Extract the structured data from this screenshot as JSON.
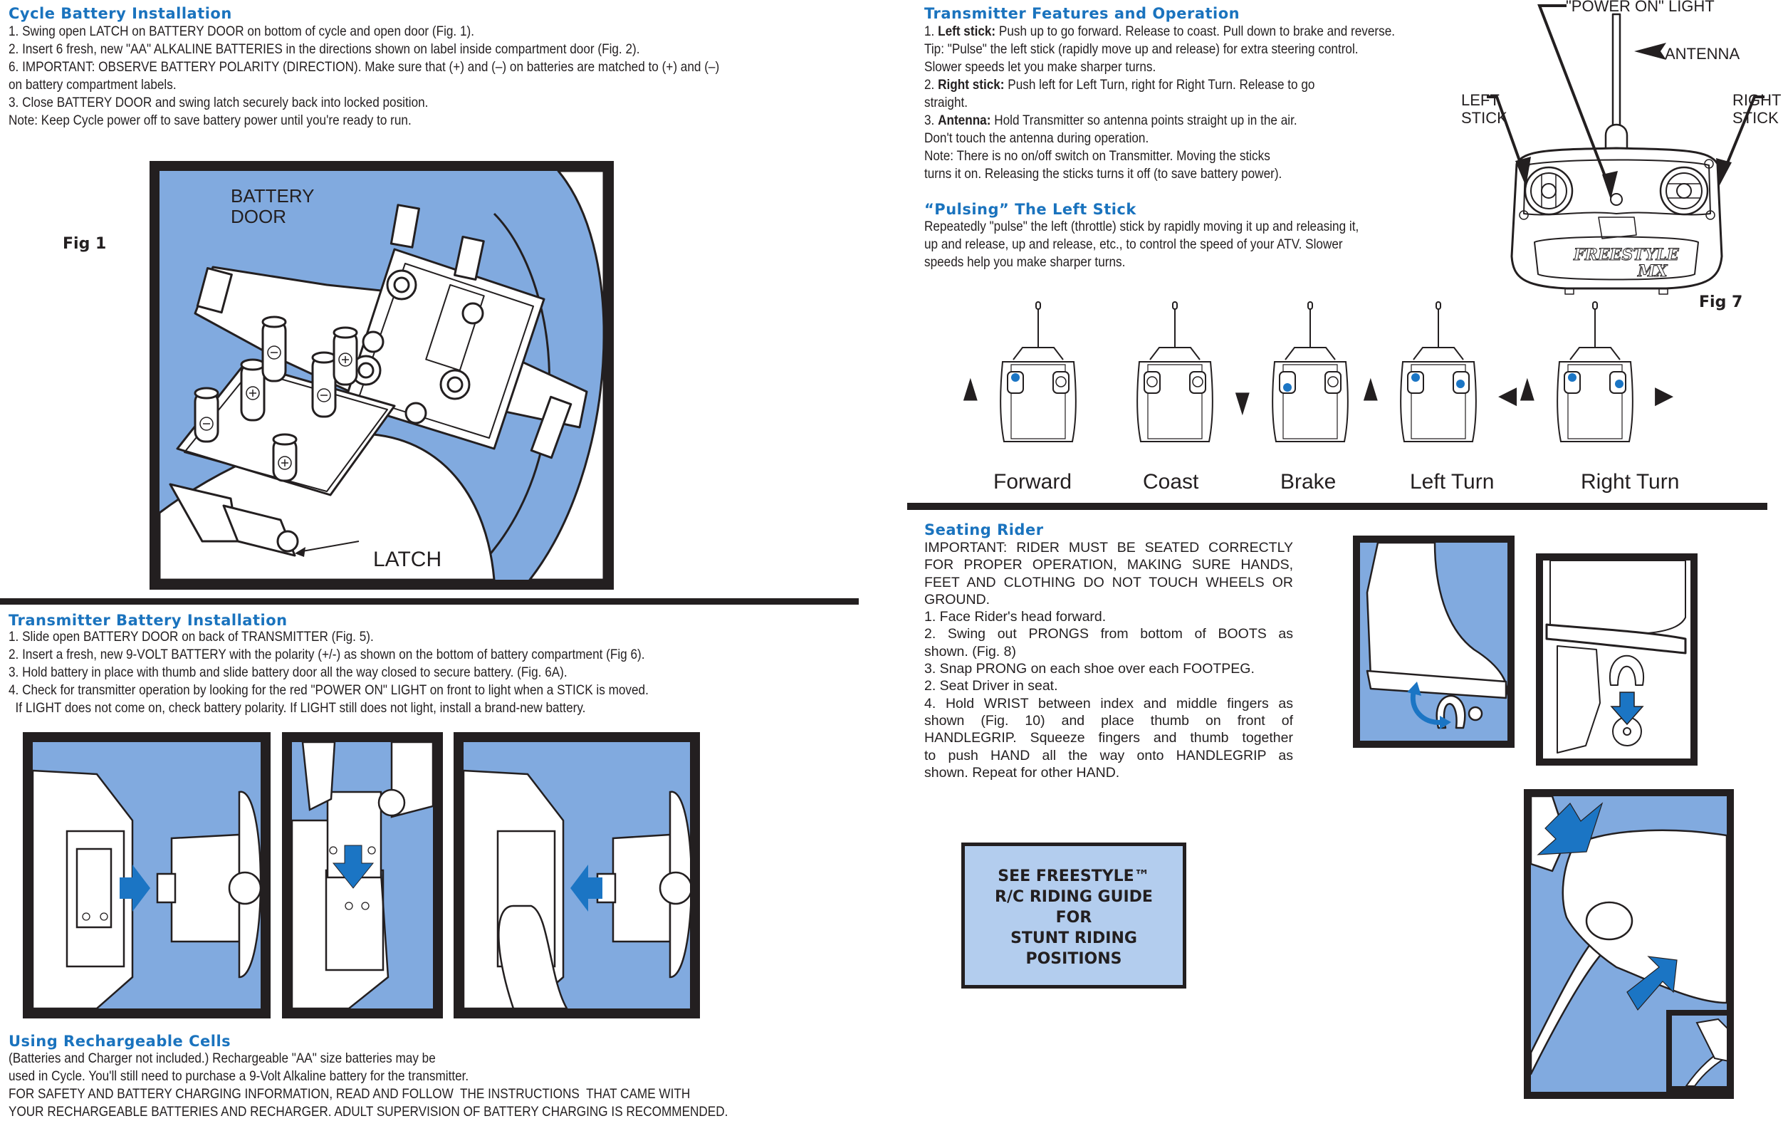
{
  "cycle_battery": {
    "title": "Cycle Battery Installation",
    "lines": [
      "1. Swing open LATCH on BATTERY DOOR on bottom of cycle and open door (Fig. 1).",
      "2. Insert 6 fresh, new \"AA\" ALKALINE BATTERIES in the directions shown on label inside compartment door (Fig. 2).",
      "6. IMPORTANT: OBSERVE BATTERY POLARITY (DIRECTION). Make sure that (+) and (–) on batteries are matched to (+) and (–)",
      "on battery compartment labels.",
      "3. Close BATTERY DOOR and swing latch securely back into locked position.",
      "Note: Keep Cycle power off to save battery power until you're ready to run."
    ],
    "fig_label": "Fig 1",
    "figure_labels": {
      "battery_door_1": "BATTERY",
      "battery_door_2": "DOOR",
      "latch": "LATCH"
    },
    "polarity": {
      "plus": "+",
      "minus": "–"
    }
  },
  "transmitter_battery": {
    "title": "Transmitter Battery Installation",
    "lines": [
      "1. Slide open BATTERY DOOR on back of  TRANSMITTER (Fig. 5).",
      "2. Insert a fresh, new 9-VOLT BATTERY with the polarity (+/-) as shown on the bottom of battery compartment (Fig 6).",
      "3. Hold battery in place with thumb and slide battery door all the way closed to secure battery. (Fig. 6A).",
      "4. Check for transmitter operation by looking for the red \"POWER ON\" LIGHT on front to light when a STICK is moved.",
      "  If LIGHT does not come on, check battery polarity. If LIGHT still does not light, install a brand-new battery."
    ]
  },
  "rechargeable": {
    "title": "Using Rechargeable Cells",
    "lines": [
      "(Batteries and Charger not included.) Rechargeable \"AA\" size batteries may be",
      "used in Cycle. You'll still need to purchase a 9-Volt Alkaline battery for the transmitter.",
      "FOR SAFETY AND BATTERY CHARGING INFORMATION, READ AND FOLLOW  THE INSTRUCTIONS  THAT CAME WITH",
      "YOUR RECHARGEABLE BATTERIES AND RECHARGER. ADULT SUPERVISION OF BATTERY CHARGING IS RECOMMENDED."
    ]
  },
  "transmitter_features": {
    "title": "Transmitter Features and Operation",
    "items": [
      {
        "num": "1. ",
        "bold": "Left stick:",
        "text": " Push up to go forward. Release to coast. Pull down to brake and reverse."
      },
      {
        "num": "",
        "bold": "",
        "text": "Tip: \"Pulse\" the left stick (rapidly move up and release) for extra steering control."
      },
      {
        "num": "",
        "bold": "",
        "text": "Slower speeds let you make sharper turns."
      },
      {
        "num": "2. ",
        "bold": "Right stick:",
        "text": " Push left for Left Turn, right for Right Turn. Release to go"
      },
      {
        "num": "",
        "bold": "",
        "text": "straight."
      },
      {
        "num": "3. ",
        "bold": "Antenna:",
        "text": " Hold Transmitter so antenna points straight up in the air."
      },
      {
        "num": "",
        "bold": "",
        "text": "Don't touch the antenna during operation."
      },
      {
        "num": "",
        "bold": "",
        "text": "Note: There is no on/off switch on Transmitter. Moving the sticks"
      },
      {
        "num": "",
        "bold": "",
        "text": "turns  it on. Releasing the sticks turns it off (to save battery power)."
      }
    ]
  },
  "pulsing": {
    "title": "“Pulsing” The Left Stick",
    "lines": [
      "Repeatedly \"pulse\" the left (throttle) stick by rapidly moving it up and releasing it,",
      "up and release, up and release, etc., to control the speed of your ATV. Slower",
      "speeds help you make sharper turns."
    ]
  },
  "fig7": {
    "fig_label": "Fig 7",
    "callouts": {
      "power_on": "\"POWER ON\" LIGHT",
      "antenna": "ANTENNA",
      "left_stick_1": "LEFT",
      "left_stick_2": "STICK",
      "right_stick_1": "RIGHT",
      "right_stick_2": "STICK"
    },
    "brand_1": "FREESTYLE",
    "brand_2": "MX",
    "controls": [
      {
        "label": "Forward",
        "left_stick": "up",
        "right_stick": "center",
        "arrows": [
          "up-left"
        ]
      },
      {
        "label": "Coast",
        "left_stick": "center",
        "right_stick": "center",
        "arrows": []
      },
      {
        "label": "Brake",
        "left_stick": "down",
        "right_stick": "center",
        "arrows": [
          "down-left"
        ]
      },
      {
        "label": "Left Turn",
        "left_stick": "up",
        "right_stick": "left",
        "arrows": [
          "up-left",
          "left-right"
        ]
      },
      {
        "label": "Right Turn",
        "left_stick": "up",
        "right_stick": "right",
        "arrows": [
          "up-left",
          "right-right"
        ]
      }
    ]
  },
  "seating_rider": {
    "title": "Seating Rider",
    "lines": [
      {
        "text": "IMPORTANT: RIDER MUST BE SEATED CORRECTLY",
        "justify": true
      },
      {
        "text": "FOR PROPER OPERATION, MAKING SURE HANDS,",
        "justify": true
      },
      {
        "text": "FEET AND CLOTHING DO NOT TOUCH WHEELS OR",
        "justify": true
      },
      {
        "text": "GROUND.",
        "justify": false
      },
      {
        "text": "1. Face Rider's head forward.",
        "justify": false
      },
      {
        "text": "2. Swing out PRONGS from bottom of BOOTS as",
        "justify": true
      },
      {
        "text": "shown. (Fig. 8)",
        "justify": false
      },
      {
        "text": "3. Snap PRONG on each shoe over each FOOTPEG.",
        "justify": false
      },
      {
        "text": "2. Seat Driver in seat.",
        "justify": false
      },
      {
        "text": "4. Hold WRIST between index and middle fingers as",
        "justify": true
      },
      {
        "text": "shown (Fig. 10) and place thumb on front of",
        "justify": true
      },
      {
        "text": "HANDLEGRIP. Squeeze fingers and thumb together",
        "justify": true
      },
      {
        "text": "to push HAND all the way onto HANDLEGRIP as",
        "justify": true
      },
      {
        "text": "shown. Repeat for other HAND.",
        "justify": false
      }
    ]
  },
  "callout_box": {
    "lines": [
      "SEE FREESTYLE™",
      "R/C RIDING GUIDE",
      "FOR",
      "STUNT RIDING",
      "POSITIONS"
    ]
  },
  "colors": {
    "heading_blue": "#1a73be",
    "panel_blue": "#81aadf",
    "arrow_blue": "#1b75c4",
    "callout_fill": "#b3cdee",
    "ink": "#231f20"
  },
  "icons": {
    "arrow_up": "▲",
    "arrow_down": "▼",
    "arrow_left": "◀",
    "arrow_right": "▶"
  }
}
